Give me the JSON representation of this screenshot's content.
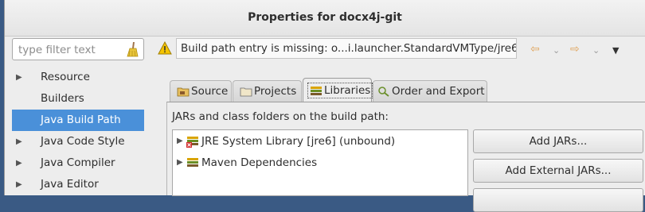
{
  "window": {
    "title": "Properties for docx4j-git"
  },
  "filter": {
    "placeholder": "type filter text"
  },
  "sidebar": {
    "items": [
      {
        "label": "Resource",
        "expandable": true,
        "selected": false
      },
      {
        "label": "Builders",
        "expandable": false,
        "selected": false
      },
      {
        "label": "Java Build Path",
        "expandable": false,
        "selected": true
      },
      {
        "label": "Java Code Style",
        "expandable": true,
        "selected": false
      },
      {
        "label": "Java Compiler",
        "expandable": true,
        "selected": false
      },
      {
        "label": "Java Editor",
        "expandable": true,
        "selected": false
      }
    ]
  },
  "header": {
    "message": "Build path entry is missing: o...i.launcher.StandardVMType/jre6"
  },
  "tabs": [
    {
      "label": "Source",
      "active": false
    },
    {
      "label": "Projects",
      "active": false
    },
    {
      "label": "Libraries",
      "active": true
    },
    {
      "label": "Order and Export",
      "active": false
    }
  ],
  "libraries": {
    "caption": "JARs and class folders on the build path:",
    "entries": [
      {
        "label": "JRE System Library [jre6] (unbound)",
        "error": true
      },
      {
        "label": "Maven Dependencies",
        "error": false
      }
    ],
    "buttons": {
      "add_jars": "Add JARs...",
      "add_external_jars": "Add External JARs..."
    }
  },
  "colors": {
    "selection": "#4a90d9",
    "warning": "#e8b100",
    "nav_arrow": "#e0a35a"
  }
}
